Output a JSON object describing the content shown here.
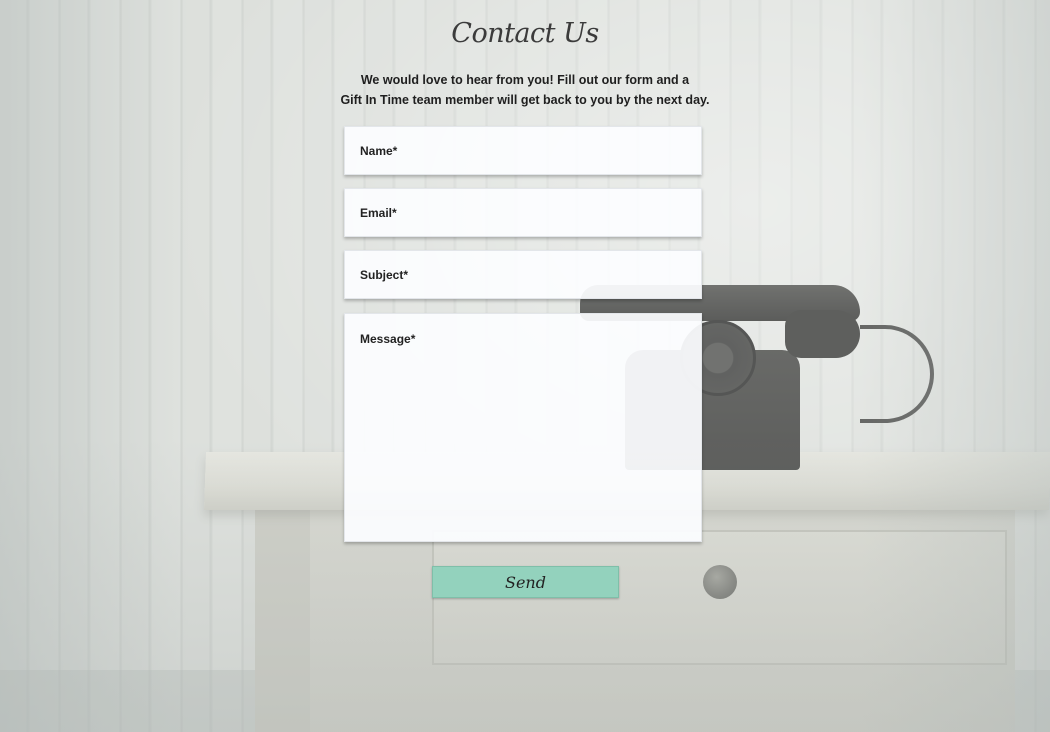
{
  "page": {
    "title": "Contact Us",
    "intro_line1": "We would love to hear from you! Fill out our form and a",
    "intro_line2": "Gift In Time team member will get back to you by the next day."
  },
  "form": {
    "name_placeholder": "Name*",
    "name_value": "",
    "email_placeholder": "Email*",
    "email_value": "",
    "subject_placeholder": "Subject*",
    "subject_value": "",
    "message_placeholder": "Message*",
    "message_value": "",
    "send_label": "Send"
  },
  "colors": {
    "send_button": "#93d2bd",
    "title_text": "#3b3b3b",
    "field_background": "#fcfdff"
  },
  "background": {
    "image": "vintage-rotary-telephone-on-desk",
    "icon": "rotary-phone"
  }
}
